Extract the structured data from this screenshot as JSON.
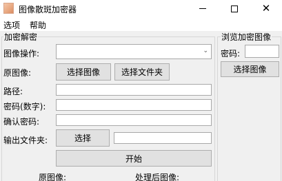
{
  "window": {
    "title": "图像散斑加密器",
    "minimize_symbol": "",
    "close_symbol": "✕"
  },
  "menu": {
    "items": [
      "选项",
      "帮助"
    ]
  },
  "encrypt_group": {
    "title": "加密解密",
    "image_operation_label": "图像操作:",
    "image_operation_value": "",
    "original_image_label": "原图像:",
    "select_image_button": "选择图像",
    "select_folder_button": "选择文件夹",
    "path_label": "路径:",
    "path_value": "",
    "password_label": "密码(数字):",
    "password_value": "",
    "confirm_password_label": "确认密码:",
    "confirm_password_value": "",
    "output_folder_label": "输出文件夹:",
    "output_select_button": "选择",
    "output_folder_value": "",
    "start_button": "开始",
    "original_preview_label": "原图像:",
    "processed_preview_label": "处理后图像:"
  },
  "browse_group": {
    "title": "浏览加密图像",
    "password_label": "密码:",
    "password_value": "",
    "select_image_button": "选择图像"
  }
}
